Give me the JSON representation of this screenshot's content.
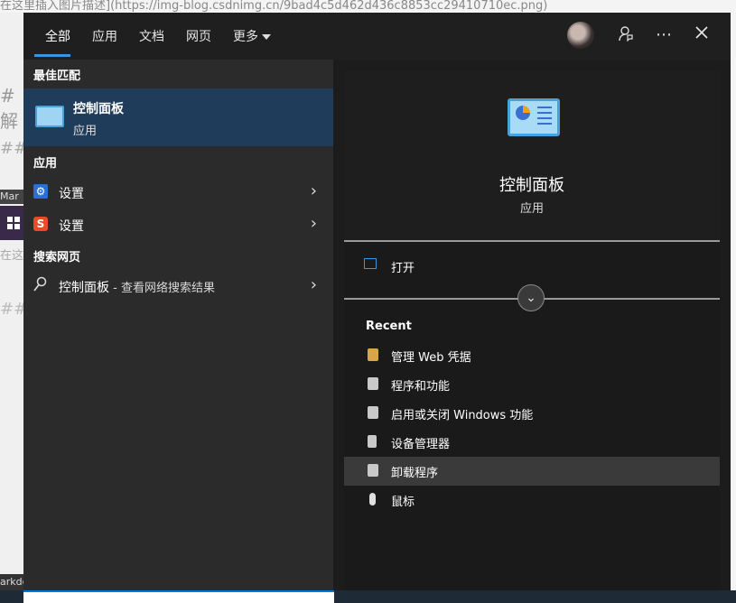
{
  "background": {
    "top_text": "在这里插入图片描述](https://img-blog.csdnimg.cn/9bad4c5d462d436c8853cc29410710ec.png)",
    "left_heading": "# 解",
    "left_heading2": "##",
    "left_tab": "Mar",
    "left_text": "在这",
    "left_heading3": "##",
    "left_tab2": "arkdo"
  },
  "tabs": [
    {
      "label": "全部",
      "active": true
    },
    {
      "label": "应用"
    },
    {
      "label": "文档"
    },
    {
      "label": "网页"
    },
    {
      "label": "更多"
    }
  ],
  "topbar": {
    "feedback_icon": "feedback-icon",
    "more_icon": "ellipsis-icon",
    "close_icon": "close-icon"
  },
  "left": {
    "best_match_title": "最佳匹配",
    "best_match": {
      "name": "控制面板",
      "type": "应用"
    },
    "apps_title": "应用",
    "apps": [
      {
        "label": "设置",
        "icon": "gear-icon"
      },
      {
        "label": "设置",
        "icon": "sogou-icon"
      }
    ],
    "web_title": "搜索网页",
    "web": {
      "label": "控制面板",
      "suffix": " - 查看网络搜索结果"
    }
  },
  "right": {
    "app_name": "控制面板",
    "app_type": "应用",
    "open_label": "打开",
    "recent_title": "Recent",
    "recent": [
      {
        "label": "管理 Web 凭据",
        "icon": "credential-icon",
        "color": "#d9a54a"
      },
      {
        "label": "程序和功能",
        "icon": "programs-icon",
        "color": "#c9c9c9"
      },
      {
        "label": "启用或关闭 Windows 功能",
        "icon": "programs-icon",
        "color": "#c9c9c9"
      },
      {
        "label": "设备管理器",
        "icon": "device-manager-icon",
        "color": "#c9c9c9"
      },
      {
        "label": "卸载程序",
        "icon": "programs-icon",
        "color": "#c9c9c9"
      },
      {
        "label": "鼠标",
        "icon": "mouse-icon",
        "color": "#e0e0e0"
      }
    ]
  },
  "colors": {
    "accent": "#3a95e0",
    "selection": "#1f3d5a"
  }
}
